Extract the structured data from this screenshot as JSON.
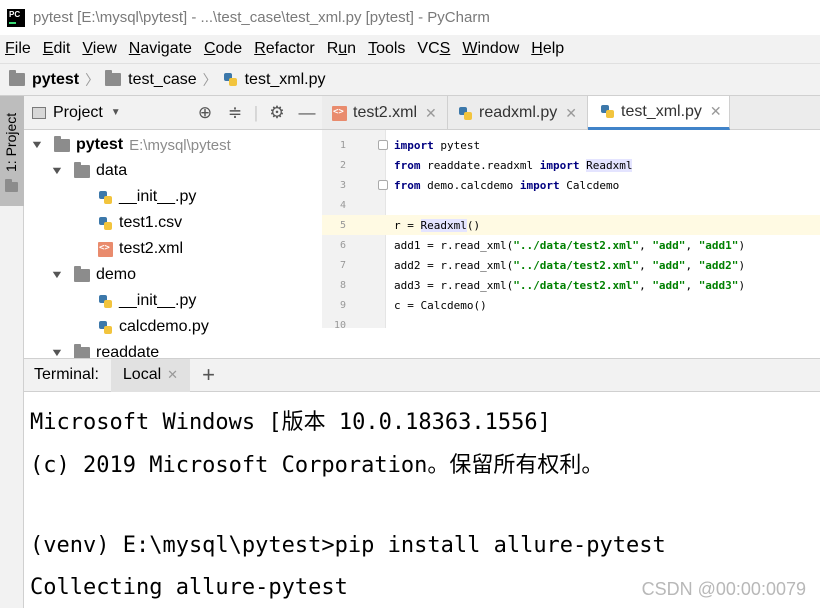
{
  "window": {
    "title": "pytest [E:\\mysql\\pytest] - ...\\test_case\\test_xml.py [pytest] - PyCharm",
    "app_icon": "pycharm-icon"
  },
  "menu": [
    {
      "label": "File",
      "mn": "F",
      "rest": "ile"
    },
    {
      "label": "Edit",
      "mn": "E",
      "rest": "dit"
    },
    {
      "label": "View",
      "mn": "V",
      "rest": "iew"
    },
    {
      "label": "Navigate",
      "mn": "N",
      "rest": "avigate"
    },
    {
      "label": "Code",
      "mn": "C",
      "rest": "ode"
    },
    {
      "label": "Refactor",
      "mn": "R",
      "rest": "efactor"
    },
    {
      "label": "Run",
      "mn": "u",
      "pre": "R",
      "rest": "n"
    },
    {
      "label": "Tools",
      "mn": "T",
      "rest": "ools"
    },
    {
      "label": "VCS",
      "mn": "S",
      "pre": "VC",
      "rest": ""
    },
    {
      "label": "Window",
      "mn": "W",
      "rest": "indow"
    },
    {
      "label": "Help",
      "mn": "H",
      "rest": "elp"
    }
  ],
  "breadcrumb": [
    "pytest",
    "test_case",
    "test_xml.py"
  ],
  "side_tool": {
    "project_label": "1: Project"
  },
  "project_panel": {
    "title": "Project",
    "tree": [
      {
        "name": "pytest",
        "path": "E:\\mysql\\pytest",
        "type": "folder",
        "level": 0,
        "open": true
      },
      {
        "name": "data",
        "type": "folder",
        "level": 1,
        "open": true
      },
      {
        "name": "__init__.py",
        "type": "py",
        "level": 2
      },
      {
        "name": "test1.csv",
        "type": "csv",
        "level": 2
      },
      {
        "name": "test2.xml",
        "type": "xml",
        "level": 2
      },
      {
        "name": "demo",
        "type": "folder",
        "level": 1,
        "open": true
      },
      {
        "name": "__init__.py",
        "type": "py",
        "level": 2
      },
      {
        "name": "calcdemo.py",
        "type": "py",
        "level": 2
      },
      {
        "name": "readdate",
        "type": "folder",
        "level": 1,
        "open": true
      }
    ]
  },
  "editor_tabs": [
    {
      "label": "test2.xml",
      "icon": "xml-file-icon",
      "active": false
    },
    {
      "label": "readxml.py",
      "icon": "python-file-icon",
      "active": false
    },
    {
      "label": "test_xml.py",
      "icon": "python-file-icon",
      "active": true
    }
  ],
  "code_lines": [
    {
      "n": "1",
      "text": "import pytest"
    },
    {
      "n": "2",
      "text": "from readdate.readxml import Readxml"
    },
    {
      "n": "3",
      "text": "from demo.calcdemo import Calcdemo"
    },
    {
      "n": "4",
      "text": ""
    },
    {
      "n": "5",
      "text": "r = Readxml()"
    },
    {
      "n": "6",
      "text": "add1 = r.read_xml(\"../data/test2.xml\", \"add\", \"add1\")"
    },
    {
      "n": "7",
      "text": "add2 = r.read_xml(\"../data/test2.xml\", \"add\", \"add2\")"
    },
    {
      "n": "8",
      "text": "add3 = r.read_xml(\"../data/test2.xml\", \"add\", \"add3\")"
    },
    {
      "n": "9",
      "text": "c = Calcdemo()"
    },
    {
      "n": "10",
      "text": ""
    }
  ],
  "terminal": {
    "label": "Terminal:",
    "tab": "Local",
    "lines": [
      "Microsoft Windows [版本 10.0.18363.1556]",
      "(c) 2019 Microsoft Corporation。保留所有权利。",
      "",
      "(venv) E:\\mysql\\pytest>pip install allure-pytest",
      "Collecting allure-pytest"
    ]
  },
  "watermark": "CSDN @00:00:0079"
}
